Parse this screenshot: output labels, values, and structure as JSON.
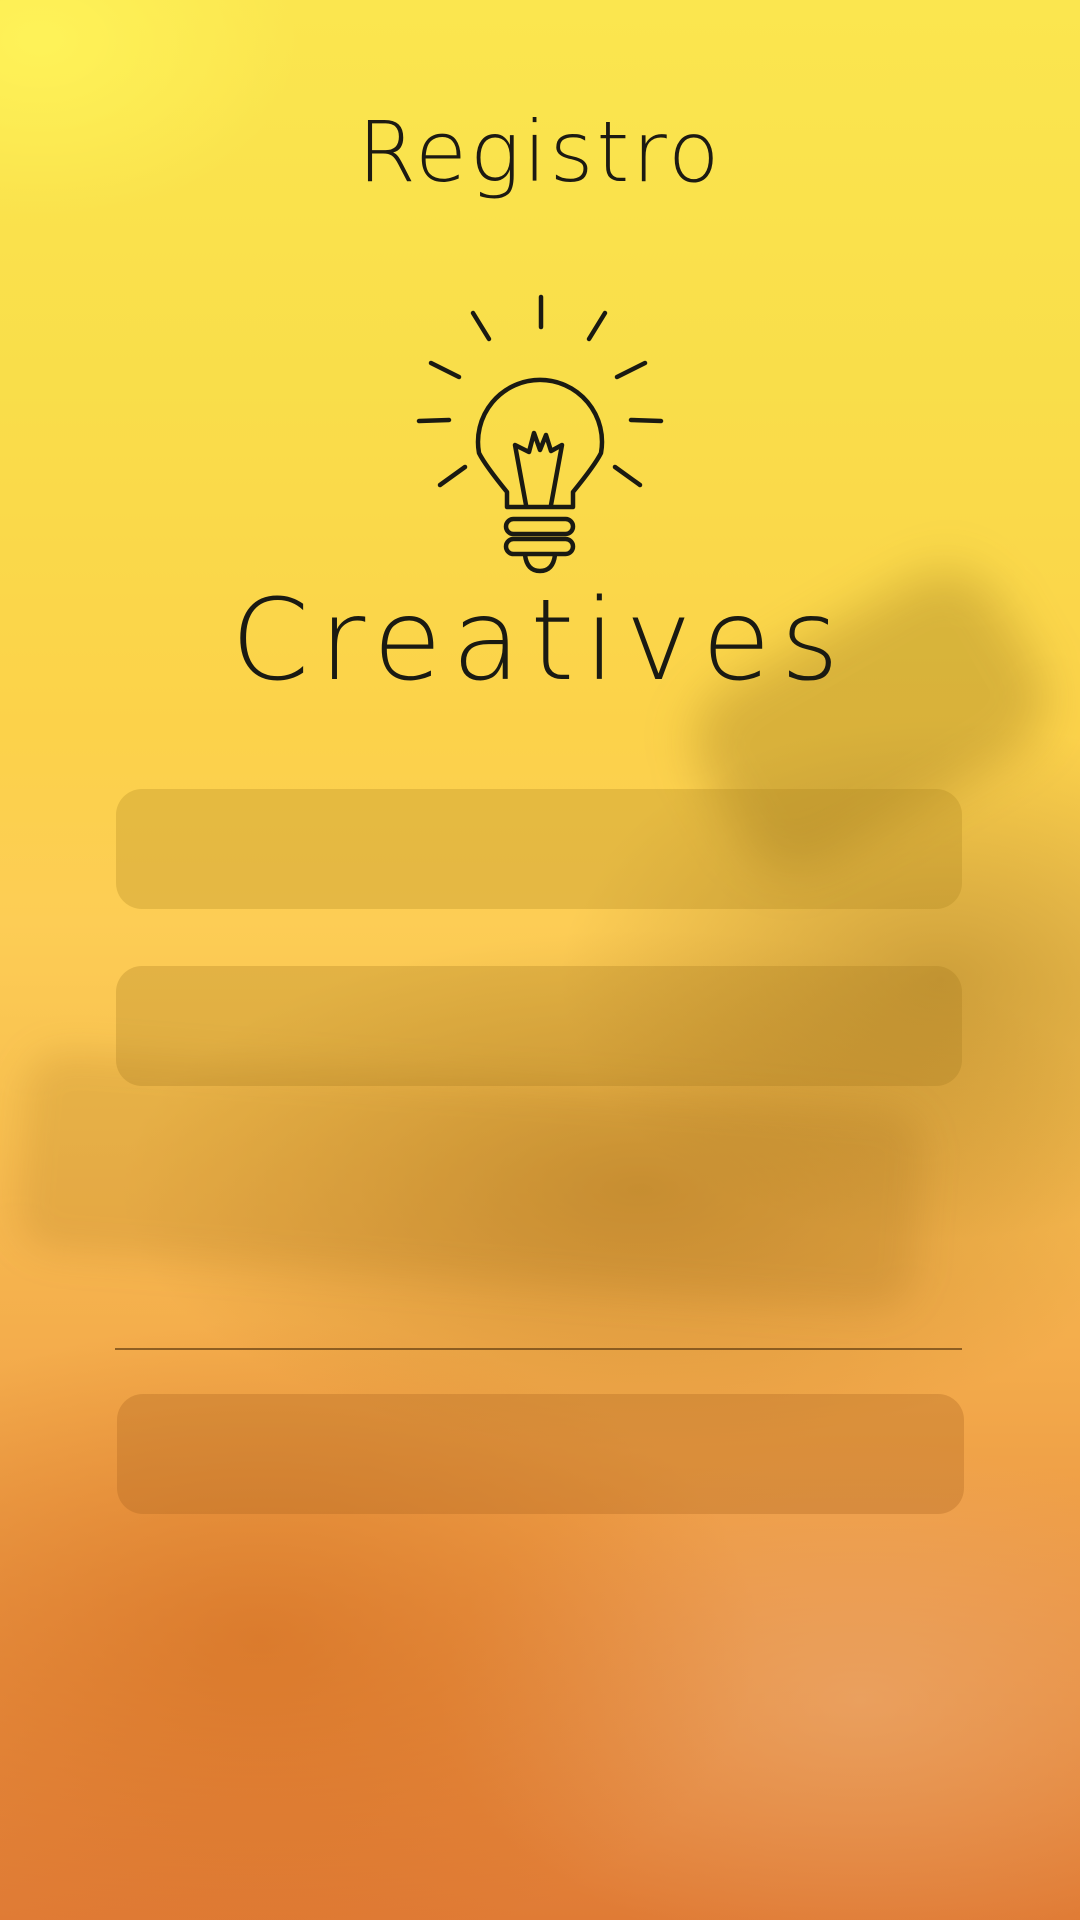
{
  "header": {
    "title": "Registro"
  },
  "brand": {
    "logo_icon": "lightbulb-icon",
    "name": "Creatives"
  },
  "form": {
    "field_1": {
      "value": "",
      "placeholder": ""
    },
    "field_2": {
      "value": "",
      "placeholder": ""
    },
    "submit_label": ""
  },
  "theme": {
    "background_top": "#fbe64f",
    "background_bottom": "#e07b35",
    "text_color": "#1c1a12"
  }
}
